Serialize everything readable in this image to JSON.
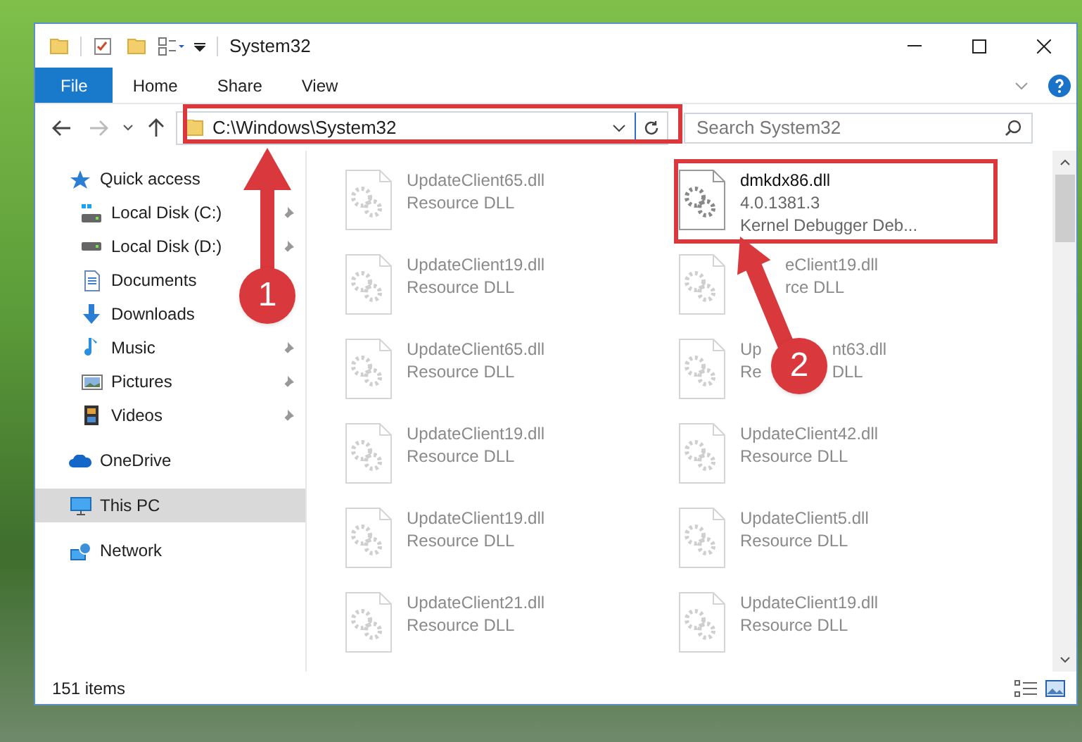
{
  "window": {
    "title": "System32"
  },
  "ribbon_tabs": [
    {
      "label": "File",
      "selected": true
    },
    {
      "label": "Home",
      "selected": false
    },
    {
      "label": "Share",
      "selected": false
    },
    {
      "label": "View",
      "selected": false
    }
  ],
  "address": {
    "path": "C:\\Windows\\System32"
  },
  "search": {
    "placeholder": "Search System32"
  },
  "sidebar": [
    {
      "label": "Quick access",
      "selected": false,
      "children": [
        {
          "label": "Local Disk (C:)",
          "pinned": true
        },
        {
          "label": "Local Disk (D:)",
          "pinned": true
        },
        {
          "label": "Documents",
          "pinned": false
        },
        {
          "label": "Downloads",
          "pinned": false
        },
        {
          "label": "Music",
          "pinned": true
        },
        {
          "label": "Pictures",
          "pinned": true
        },
        {
          "label": "Videos",
          "pinned": true
        }
      ]
    },
    {
      "label": "OneDrive",
      "selected": false
    },
    {
      "label": "This PC",
      "selected": true
    },
    {
      "label": "Network",
      "selected": false
    }
  ],
  "files": [
    {
      "lines": [
        [
          "UpdateClient65.dll"
        ],
        [
          "Resource DLL"
        ]
      ],
      "faded": true
    },
    {
      "lines": [
        [
          "dmkdx86.dll"
        ],
        [
          "4.0.1381.3"
        ],
        [
          "Kernel Debugger Deb..."
        ]
      ],
      "faded": false,
      "annotated": true
    },
    {
      "lines": [
        [
          "UpdateClient19.dll"
        ],
        [
          "Resource DLL"
        ]
      ],
      "faded": true
    },
    {
      "lines": [
        [
          "eClient19.dll"
        ],
        [
          "rce DLL"
        ]
      ],
      "faded": true
    },
    {
      "lines": [
        [
          "UpdateClient65.dll"
        ],
        [
          "Resource DLL"
        ]
      ],
      "faded": true
    },
    {
      "lines": [
        [
          "Up",
          "nt63.dll"
        ],
        [
          "Re",
          "DLL"
        ]
      ],
      "faded": true
    },
    {
      "lines": [
        [
          "UpdateClient19.dll"
        ],
        [
          "Resource DLL"
        ]
      ],
      "faded": true
    },
    {
      "lines": [
        [
          "UpdateClient42.dll"
        ],
        [
          "Resource DLL"
        ]
      ],
      "faded": true
    },
    {
      "lines": [
        [
          "UpdateClient19.dll"
        ],
        [
          "Resource DLL"
        ]
      ],
      "faded": true
    },
    {
      "lines": [
        [
          "UpdateClient5.dll"
        ],
        [
          "Resource DLL"
        ]
      ],
      "faded": true
    },
    {
      "lines": [
        [
          "UpdateClient21.dll"
        ],
        [
          "Resource DLL"
        ]
      ],
      "faded": true
    },
    {
      "lines": [
        [
          "UpdateClient19.dll"
        ],
        [
          "Resource DLL"
        ]
      ],
      "faded": true
    }
  ],
  "status_bar": {
    "item_count": "151 items"
  },
  "annotations": [
    {
      "number": "1"
    },
    {
      "number": "2"
    }
  ]
}
